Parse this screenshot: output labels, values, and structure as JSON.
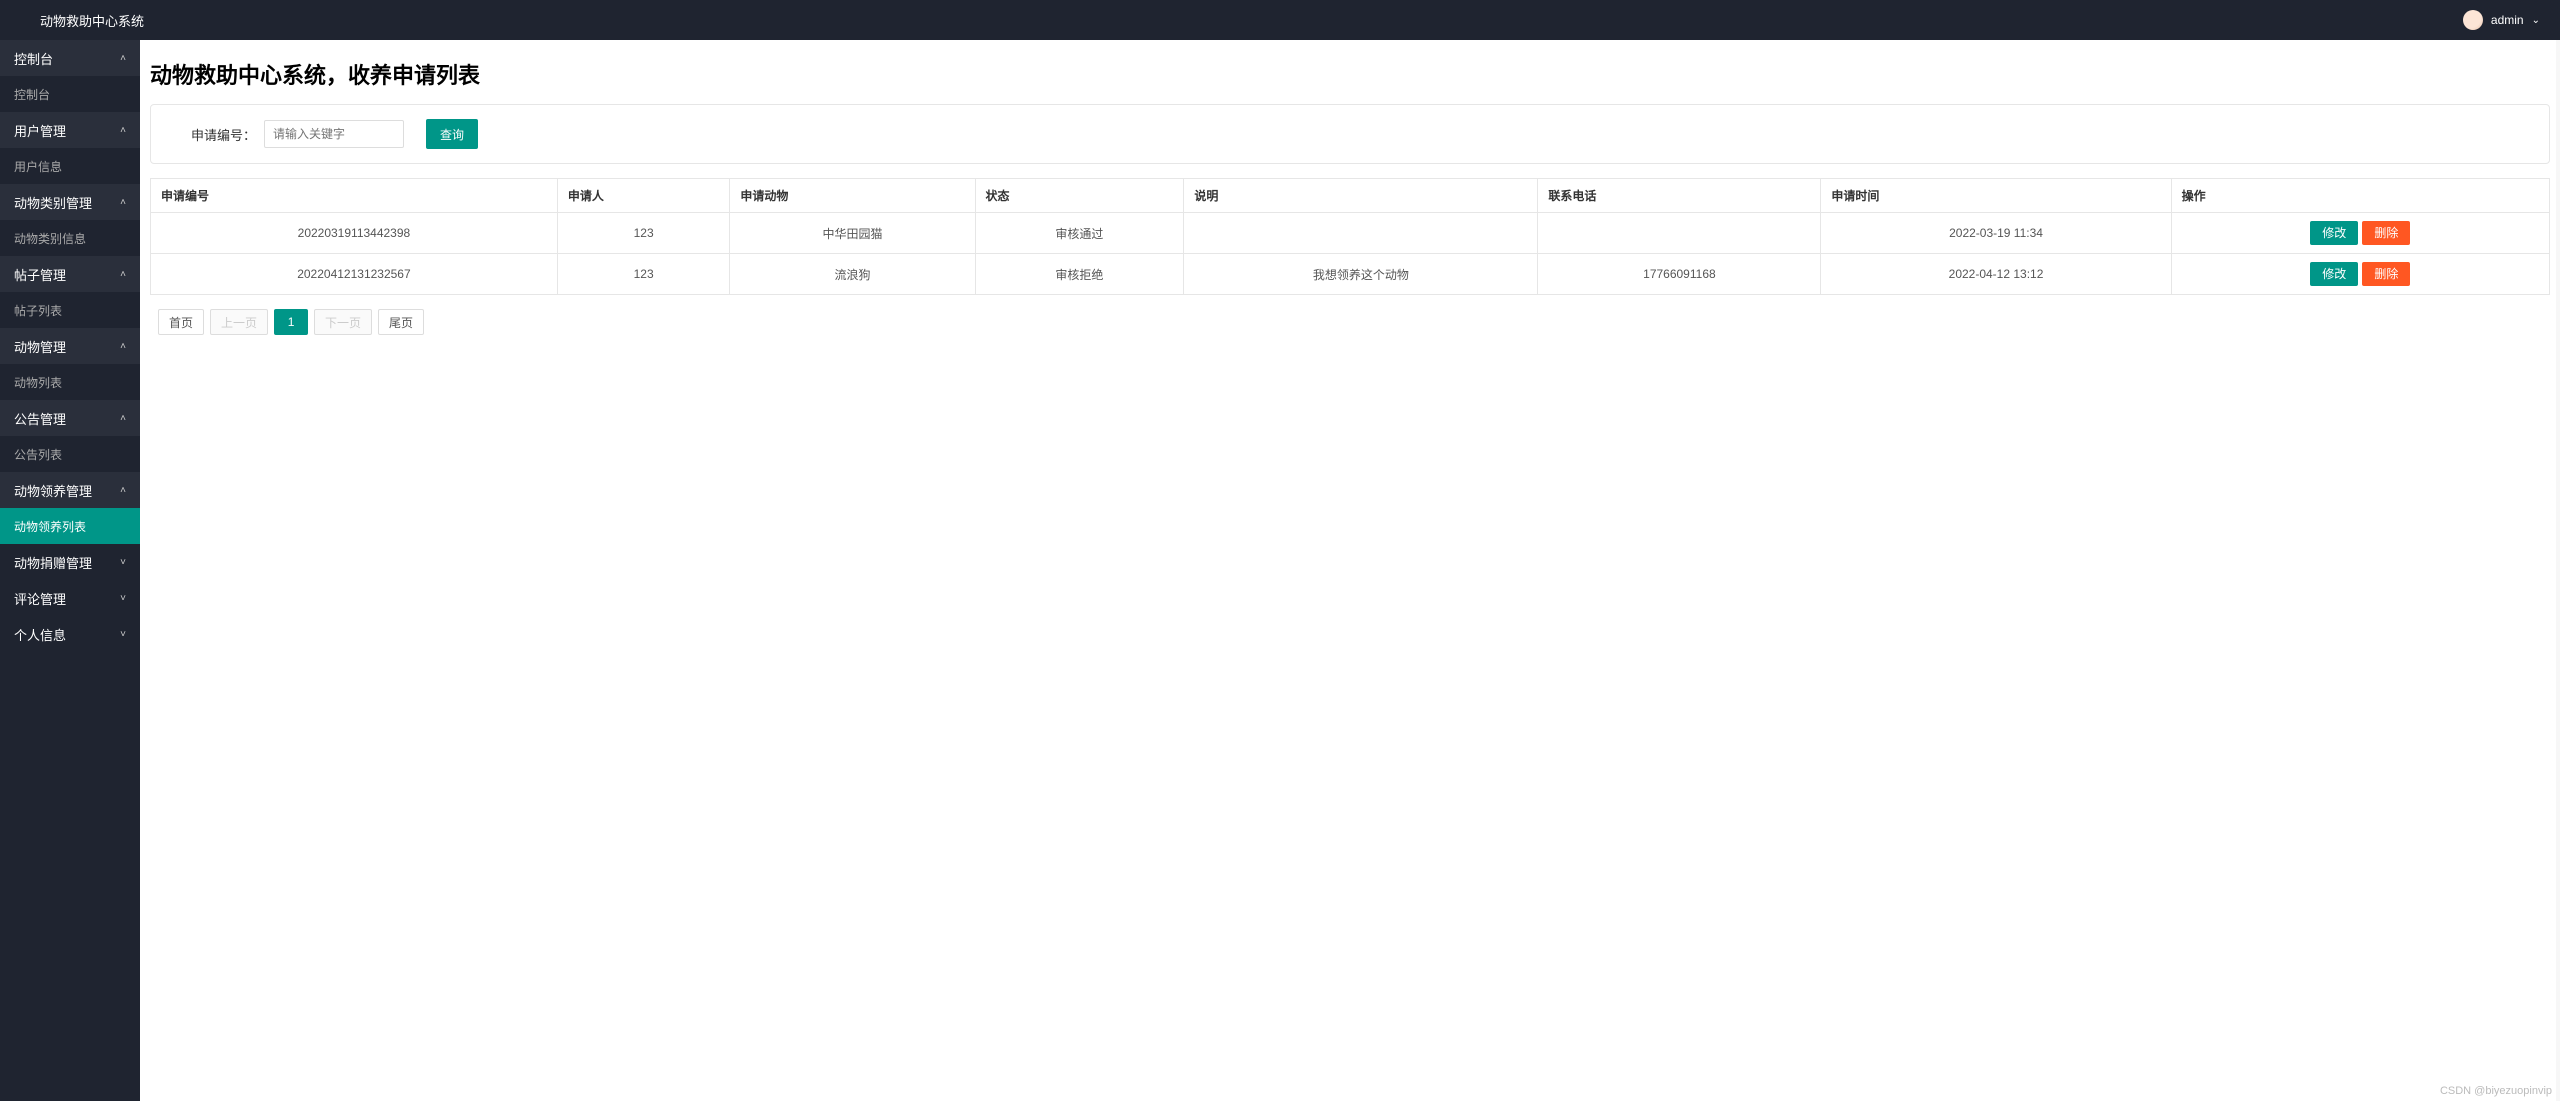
{
  "header": {
    "brand": "动物救助中心系统",
    "username": "admin"
  },
  "sidebar": {
    "groups": [
      {
        "label": "控制台",
        "expanded": true,
        "items": [
          {
            "label": "控制台",
            "active": false
          }
        ]
      },
      {
        "label": "用户管理",
        "expanded": true,
        "items": [
          {
            "label": "用户信息",
            "active": false
          }
        ]
      },
      {
        "label": "动物类别管理",
        "expanded": true,
        "items": [
          {
            "label": "动物类别信息",
            "active": false
          }
        ]
      },
      {
        "label": "帖子管理",
        "expanded": true,
        "items": [
          {
            "label": "帖子列表",
            "active": false
          }
        ]
      },
      {
        "label": "动物管理",
        "expanded": true,
        "items": [
          {
            "label": "动物列表",
            "active": false
          }
        ]
      },
      {
        "label": "公告管理",
        "expanded": true,
        "items": [
          {
            "label": "公告列表",
            "active": false
          }
        ]
      },
      {
        "label": "动物领养管理",
        "expanded": true,
        "items": [
          {
            "label": "动物领养列表",
            "active": true
          }
        ]
      },
      {
        "label": "动物捐赠管理",
        "expanded": false,
        "items": []
      },
      {
        "label": "评论管理",
        "expanded": false,
        "items": []
      },
      {
        "label": "个人信息",
        "expanded": false,
        "items": []
      }
    ]
  },
  "page": {
    "title": "动物救助中心系统，收养申请列表"
  },
  "search": {
    "label": "申请编号：",
    "placeholder": "请输入关键字",
    "value": "",
    "button": "查询"
  },
  "table": {
    "headers": [
      "申请编号",
      "申请人",
      "申请动物",
      "状态",
      "说明",
      "联系电话",
      "申请时间",
      "操作"
    ],
    "rows": [
      {
        "id": "20220319113442398",
        "applicant": "123",
        "animal": "中华田园猫",
        "status": "审核通过",
        "note": "",
        "phone": "",
        "time": "2022-03-19 11:34"
      },
      {
        "id": "20220412131232567",
        "applicant": "123",
        "animal": "流浪狗",
        "status": "审核拒绝",
        "note": "我想领养这个动物",
        "phone": "17766091168",
        "time": "2022-04-12 13:12"
      }
    ],
    "actions": {
      "edit": "修改",
      "delete": "删除"
    }
  },
  "pagination": {
    "first": "首页",
    "prev": "上一页",
    "current": "1",
    "next": "下一页",
    "last": "尾页"
  },
  "watermark": "CSDN @biyezuopinvip"
}
